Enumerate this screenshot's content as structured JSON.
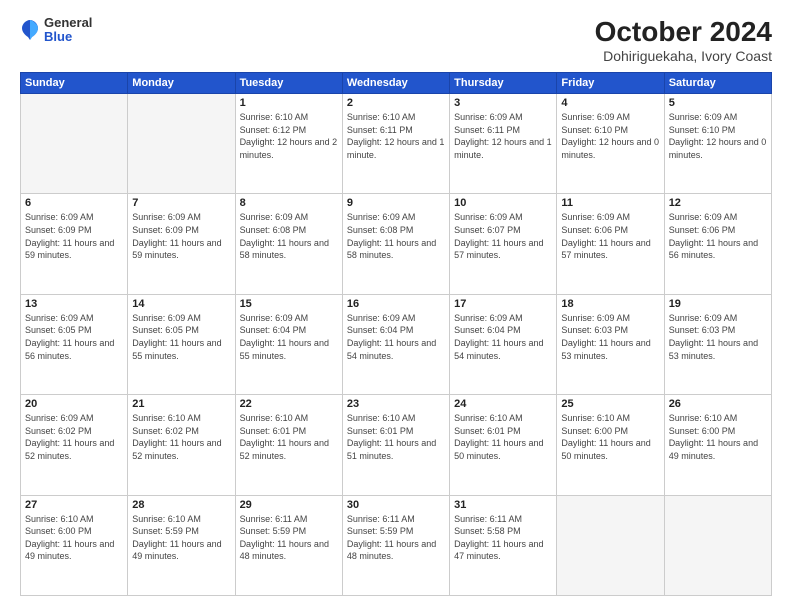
{
  "header": {
    "logo_general": "General",
    "logo_blue": "Blue",
    "title": "October 2024",
    "subtitle": "Dohiriguekaha, Ivory Coast"
  },
  "days_of_week": [
    "Sunday",
    "Monday",
    "Tuesday",
    "Wednesday",
    "Thursday",
    "Friday",
    "Saturday"
  ],
  "weeks": [
    [
      {
        "day": "",
        "empty": true
      },
      {
        "day": "",
        "empty": true
      },
      {
        "day": "1",
        "sunrise": "6:10 AM",
        "sunset": "6:12 PM",
        "daylight": "12 hours and 2 minutes."
      },
      {
        "day": "2",
        "sunrise": "6:10 AM",
        "sunset": "6:11 PM",
        "daylight": "12 hours and 1 minute."
      },
      {
        "day": "3",
        "sunrise": "6:09 AM",
        "sunset": "6:11 PM",
        "daylight": "12 hours and 1 minute."
      },
      {
        "day": "4",
        "sunrise": "6:09 AM",
        "sunset": "6:10 PM",
        "daylight": "12 hours and 0 minutes."
      },
      {
        "day": "5",
        "sunrise": "6:09 AM",
        "sunset": "6:10 PM",
        "daylight": "12 hours and 0 minutes."
      }
    ],
    [
      {
        "day": "6",
        "sunrise": "6:09 AM",
        "sunset": "6:09 PM",
        "daylight": "11 hours and 59 minutes."
      },
      {
        "day": "7",
        "sunrise": "6:09 AM",
        "sunset": "6:09 PM",
        "daylight": "11 hours and 59 minutes."
      },
      {
        "day": "8",
        "sunrise": "6:09 AM",
        "sunset": "6:08 PM",
        "daylight": "11 hours and 58 minutes."
      },
      {
        "day": "9",
        "sunrise": "6:09 AM",
        "sunset": "6:08 PM",
        "daylight": "11 hours and 58 minutes."
      },
      {
        "day": "10",
        "sunrise": "6:09 AM",
        "sunset": "6:07 PM",
        "daylight": "11 hours and 57 minutes."
      },
      {
        "day": "11",
        "sunrise": "6:09 AM",
        "sunset": "6:06 PM",
        "daylight": "11 hours and 57 minutes."
      },
      {
        "day": "12",
        "sunrise": "6:09 AM",
        "sunset": "6:06 PM",
        "daylight": "11 hours and 56 minutes."
      }
    ],
    [
      {
        "day": "13",
        "sunrise": "6:09 AM",
        "sunset": "6:05 PM",
        "daylight": "11 hours and 56 minutes."
      },
      {
        "day": "14",
        "sunrise": "6:09 AM",
        "sunset": "6:05 PM",
        "daylight": "11 hours and 55 minutes."
      },
      {
        "day": "15",
        "sunrise": "6:09 AM",
        "sunset": "6:04 PM",
        "daylight": "11 hours and 55 minutes."
      },
      {
        "day": "16",
        "sunrise": "6:09 AM",
        "sunset": "6:04 PM",
        "daylight": "11 hours and 54 minutes."
      },
      {
        "day": "17",
        "sunrise": "6:09 AM",
        "sunset": "6:04 PM",
        "daylight": "11 hours and 54 minutes."
      },
      {
        "day": "18",
        "sunrise": "6:09 AM",
        "sunset": "6:03 PM",
        "daylight": "11 hours and 53 minutes."
      },
      {
        "day": "19",
        "sunrise": "6:09 AM",
        "sunset": "6:03 PM",
        "daylight": "11 hours and 53 minutes."
      }
    ],
    [
      {
        "day": "20",
        "sunrise": "6:09 AM",
        "sunset": "6:02 PM",
        "daylight": "11 hours and 52 minutes."
      },
      {
        "day": "21",
        "sunrise": "6:10 AM",
        "sunset": "6:02 PM",
        "daylight": "11 hours and 52 minutes."
      },
      {
        "day": "22",
        "sunrise": "6:10 AM",
        "sunset": "6:01 PM",
        "daylight": "11 hours and 52 minutes."
      },
      {
        "day": "23",
        "sunrise": "6:10 AM",
        "sunset": "6:01 PM",
        "daylight": "11 hours and 51 minutes."
      },
      {
        "day": "24",
        "sunrise": "6:10 AM",
        "sunset": "6:01 PM",
        "daylight": "11 hours and 50 minutes."
      },
      {
        "day": "25",
        "sunrise": "6:10 AM",
        "sunset": "6:00 PM",
        "daylight": "11 hours and 50 minutes."
      },
      {
        "day": "26",
        "sunrise": "6:10 AM",
        "sunset": "6:00 PM",
        "daylight": "11 hours and 49 minutes."
      }
    ],
    [
      {
        "day": "27",
        "sunrise": "6:10 AM",
        "sunset": "6:00 PM",
        "daylight": "11 hours and 49 minutes."
      },
      {
        "day": "28",
        "sunrise": "6:10 AM",
        "sunset": "5:59 PM",
        "daylight": "11 hours and 49 minutes."
      },
      {
        "day": "29",
        "sunrise": "6:11 AM",
        "sunset": "5:59 PM",
        "daylight": "11 hours and 48 minutes."
      },
      {
        "day": "30",
        "sunrise": "6:11 AM",
        "sunset": "5:59 PM",
        "daylight": "11 hours and 48 minutes."
      },
      {
        "day": "31",
        "sunrise": "6:11 AM",
        "sunset": "5:58 PM",
        "daylight": "11 hours and 47 minutes."
      },
      {
        "day": "",
        "empty": true
      },
      {
        "day": "",
        "empty": true
      }
    ]
  ]
}
